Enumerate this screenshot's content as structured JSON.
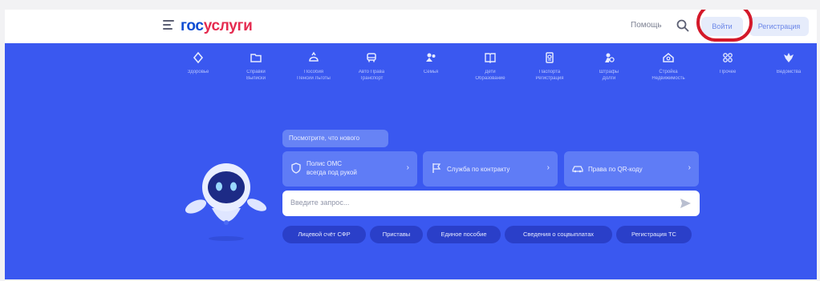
{
  "header": {
    "logo_part1": "гос",
    "logo_part2": "услуги",
    "help_label": "Помощь",
    "login_label": "Войти",
    "register_label": "Регистрация"
  },
  "categories": [
    {
      "icon": "document-icon",
      "label1": "Здоровье",
      "label2": ""
    },
    {
      "icon": "folder-icon",
      "label1": "Справки",
      "label2": "Выписки"
    },
    {
      "icon": "house-icon",
      "label1": "Пособия",
      "label2": "Пенсии Льготы"
    },
    {
      "icon": "car-icon",
      "label1": "Авто Права",
      "label2": "Транспорт"
    },
    {
      "icon": "family-icon",
      "label1": "Семья",
      "label2": ""
    },
    {
      "icon": "book-icon",
      "label1": "Дети",
      "label2": "Образование"
    },
    {
      "icon": "passport-icon",
      "label1": "Паспорта",
      "label2": "Регистрация"
    },
    {
      "icon": "fines-icon",
      "label1": "Штрафы",
      "label2": "Долги"
    },
    {
      "icon": "building-icon",
      "label1": "Стройка",
      "label2": "Недвижимость"
    },
    {
      "icon": "grid-icon",
      "label1": "Прочее",
      "label2": ""
    },
    {
      "icon": "emblem-icon",
      "label1": "Ведомства",
      "label2": ""
    }
  ],
  "hero": {
    "whatsnew_label": "Посмотрите, что нового",
    "quick_cards": [
      {
        "icon": "shield-icon",
        "line1": "Полис ОМС",
        "line2": "всегда под рукой"
      },
      {
        "icon": "flag-icon",
        "line1": "Служба по контракту",
        "line2": ""
      },
      {
        "icon": "car-icon",
        "line1": "Права по QR-коду",
        "line2": ""
      }
    ],
    "search_placeholder": "Введите запрос...",
    "chips": [
      "Лицевой счёт СФР",
      "Приставы",
      "Единое пособие",
      "Сведения о соцвыплатах",
      "Регистрация ТС"
    ]
  },
  "colors": {
    "hero_bg": "#3a58f0",
    "logo_blue": "#0d4cd3",
    "logo_red": "#e52b50",
    "highlight_circle": "#d4192a"
  }
}
